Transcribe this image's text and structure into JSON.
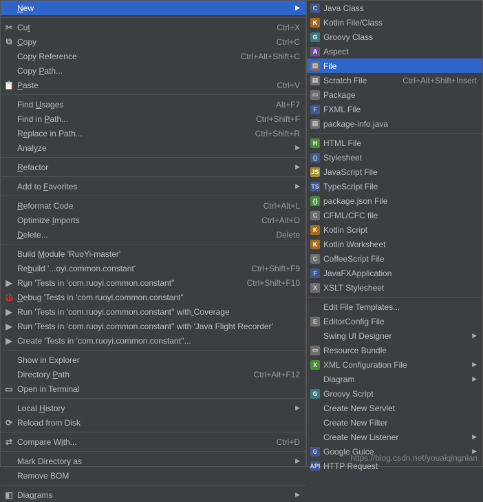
{
  "left": {
    "items": [
      {
        "label": "New",
        "underline": 0,
        "shortcut": "",
        "arrow": true,
        "icon": null,
        "highlighted": true
      },
      "sep",
      {
        "label": "Cut",
        "underline": 2,
        "shortcut": "Ctrl+X",
        "icon": "scissors"
      },
      {
        "label": "Copy",
        "underline": 0,
        "shortcut": "Ctrl+C",
        "icon": "copy"
      },
      {
        "label": "Copy Reference",
        "shortcut": "Ctrl+Alt+Shift+C"
      },
      {
        "label": "Copy Path...",
        "underline": 5
      },
      {
        "label": "Paste",
        "underline": 0,
        "shortcut": "Ctrl+V",
        "icon": "paste"
      },
      "sep",
      {
        "label": "Find Usages",
        "underline": 5,
        "shortcut": "Alt+F7"
      },
      {
        "label": "Find in Path...",
        "underline": 8,
        "shortcut": "Ctrl+Shift+F"
      },
      {
        "label": "Replace in Path...",
        "underline": 1,
        "shortcut": "Ctrl+Shift+R"
      },
      {
        "label": "Analyze",
        "underline": 4,
        "arrow": true
      },
      "sep",
      {
        "label": "Refactor",
        "underline": 0,
        "arrow": true
      },
      "sep",
      {
        "label": "Add to Favorites",
        "underline": 7,
        "arrow": true
      },
      "sep",
      {
        "label": "Reformat Code",
        "underline": 0,
        "shortcut": "Ctrl+Alt+L"
      },
      {
        "label": "Optimize Imports",
        "underline": 9,
        "shortcut": "Ctrl+Alt+O"
      },
      {
        "label": "Delete...",
        "underline": 0,
        "shortcut": "Delete"
      },
      "sep",
      {
        "label": "Build Module 'RuoYi-master'",
        "underline": 6
      },
      {
        "label": "Rebuild '...oyi.common.constant'",
        "underline": 2,
        "shortcut": "Ctrl+Shift+F9"
      },
      {
        "label": "Run 'Tests in 'com.ruoyi.common.constant''",
        "underline": 1,
        "shortcut": "Ctrl+Shift+F10",
        "icon": "run"
      },
      {
        "label": "Debug 'Tests in 'com.ruoyi.common.constant''",
        "underline": 0,
        "icon": "debug"
      },
      {
        "label": "Run 'Tests in 'com.ruoyi.common.constant'' with Coverage",
        "underline": 47,
        "icon": "coverage"
      },
      {
        "label": "Run 'Tests in 'com.ruoyi.common.constant'' with 'Java Flight Recorder'",
        "icon": "run"
      },
      {
        "label": "Create 'Tests in 'com.ruoyi.common.constant''...",
        "icon": "create"
      },
      "sep",
      {
        "label": "Show in Explorer"
      },
      {
        "label": "Directory Path",
        "underline": 10,
        "shortcut": "Ctrl+Alt+F12"
      },
      {
        "label": "Open in Terminal",
        "icon": "terminal"
      },
      "sep",
      {
        "label": "Local History",
        "underline": 6,
        "arrow": true
      },
      {
        "label": "Reload from Disk",
        "icon": "reload"
      },
      "sep",
      {
        "label": "Compare With...",
        "underline": 9,
        "shortcut": "Ctrl+D",
        "icon": "compare"
      },
      "sep",
      {
        "label": "Mark Directory as",
        "arrow": true
      },
      {
        "label": "Remove BOM"
      },
      "sep",
      {
        "label": "Diagrams",
        "underline": 4,
        "arrow": true,
        "icon": "diagram"
      }
    ]
  },
  "right": {
    "items": [
      {
        "label": "Java Class",
        "icon": "java",
        "cls": "c-blue"
      },
      {
        "label": "Kotlin File/Class",
        "icon": "kotlin",
        "cls": "c-orange"
      },
      {
        "label": "Groovy Class",
        "icon": "groovy",
        "cls": "c-teal"
      },
      {
        "label": "Aspect",
        "icon": "aspect",
        "cls": "c-purple"
      },
      {
        "label": "File",
        "icon": "file",
        "cls": "c-gray",
        "highlighted": true
      },
      {
        "label": "Scratch File",
        "shortcut": "Ctrl+Alt+Shift+Insert",
        "icon": "scratch",
        "cls": "c-gray"
      },
      {
        "label": "Package",
        "icon": "package",
        "cls": "c-gray"
      },
      {
        "label": "FXML File",
        "icon": "fxml",
        "cls": "c-blue"
      },
      {
        "label": "package-info.java",
        "icon": "pkginfo",
        "cls": "c-gray"
      },
      "sep",
      {
        "label": "HTML File",
        "icon": "html",
        "cls": "c-green"
      },
      {
        "label": "Stylesheet",
        "icon": "css",
        "cls": "c-blue"
      },
      {
        "label": "JavaScript File",
        "icon": "js",
        "cls": "c-yellow"
      },
      {
        "label": "TypeScript File",
        "icon": "ts",
        "cls": "c-blue"
      },
      {
        "label": "package.json File",
        "icon": "pkgjson",
        "cls": "c-green"
      },
      {
        "label": "CFML/CFC file",
        "icon": "cfml",
        "cls": "c-gray"
      },
      {
        "label": "Kotlin Script",
        "icon": "kts",
        "cls": "c-orange"
      },
      {
        "label": "Kotlin Worksheet",
        "icon": "ktw",
        "cls": "c-orange"
      },
      {
        "label": "CoffeeScript File",
        "icon": "coffee",
        "cls": "c-gray"
      },
      {
        "label": "JavaFXApplication",
        "icon": "fx",
        "cls": "c-blue"
      },
      {
        "label": "XSLT Stylesheet",
        "icon": "xslt",
        "cls": "c-gray"
      },
      "sep",
      {
        "label": "Edit File Templates..."
      },
      {
        "label": "EditorConfig File",
        "icon": "edconf",
        "cls": "c-gray"
      },
      {
        "label": "Swing UI Designer",
        "arrow": true
      },
      {
        "label": "Resource Bundle",
        "icon": "bundle",
        "cls": "c-gray"
      },
      {
        "label": "XML Configuration File",
        "arrow": true,
        "icon": "xml",
        "cls": "c-green"
      },
      {
        "label": "Diagram",
        "arrow": true
      },
      {
        "label": "Groovy Script",
        "icon": "gscript",
        "cls": "c-teal"
      },
      {
        "label": "Create New Servlet"
      },
      {
        "label": "Create New Filter"
      },
      {
        "label": "Create New Listener",
        "arrow": true
      },
      {
        "label": "Google Guice",
        "arrow": true,
        "icon": "guice",
        "cls": "c-blue"
      },
      {
        "label": "HTTP Request",
        "icon": "http",
        "cls": "c-blue"
      }
    ]
  },
  "icon_glyphs": {
    "scissors": "✂",
    "copy": "⧉",
    "paste": "📋",
    "run": "▶",
    "debug": "🐞",
    "coverage": "▶",
    "create": "▶",
    "terminal": "▭",
    "reload": "⟳",
    "compare": "⇄",
    "diagram": "◧",
    "java": "C",
    "kotlin": "K",
    "groovy": "G",
    "aspect": "A",
    "file": "▤",
    "scratch": "▤",
    "package": "▭",
    "fxml": "F",
    "pkginfo": "▤",
    "html": "H",
    "css": "{}",
    "js": "JS",
    "ts": "TS",
    "pkgjson": "{}",
    "cfml": "C",
    "kts": "K",
    "ktw": "K",
    "coffee": "C",
    "fx": "F",
    "xslt": "X",
    "edconf": "E",
    "bundle": "▭",
    "xml": "X",
    "gscript": "G",
    "guice": "G",
    "http": "API"
  },
  "watermark": "https://blog.csdn.net/youaiqingnian"
}
